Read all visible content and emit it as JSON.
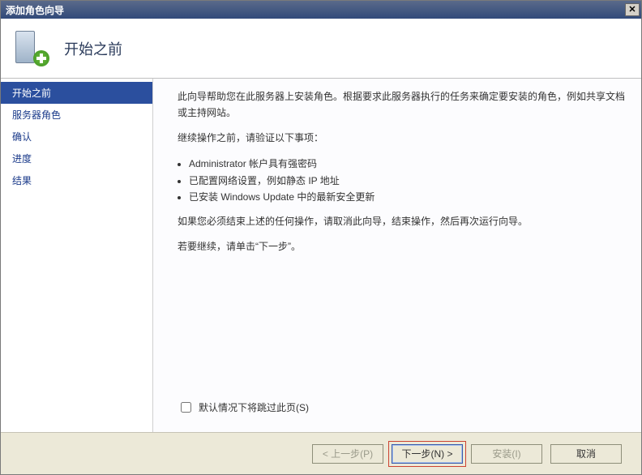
{
  "window": {
    "title": "添加角色向导"
  },
  "header": {
    "title": "开始之前"
  },
  "sidebar": {
    "items": [
      {
        "label": "开始之前",
        "selected": true
      },
      {
        "label": "服务器角色",
        "selected": false
      },
      {
        "label": "确认",
        "selected": false
      },
      {
        "label": "进度",
        "selected": false
      },
      {
        "label": "结果",
        "selected": false
      }
    ]
  },
  "content": {
    "intro": "此向导帮助您在此服务器上安装角色。根据要求此服务器执行的任务来确定要安装的角色，例如共享文档或主持网站。",
    "verify_heading": "继续操作之前，请验证以下事项：",
    "bullets": [
      "Administrator 帐户具有强密码",
      "已配置网络设置，例如静态 IP 地址",
      "已安装 Windows Update 中的最新安全更新"
    ],
    "warning": "如果您必须结束上述的任何操作，请取消此向导，结束操作，然后再次运行向导。",
    "continue_hint": "若要继续，请单击“下一步”。",
    "skip_checkbox_label": "默认情况下将跳过此页(S)"
  },
  "buttons": {
    "back": "< 上一步(P)",
    "next": "下一步(N) >",
    "install": "安装(I)",
    "cancel": "取消"
  }
}
